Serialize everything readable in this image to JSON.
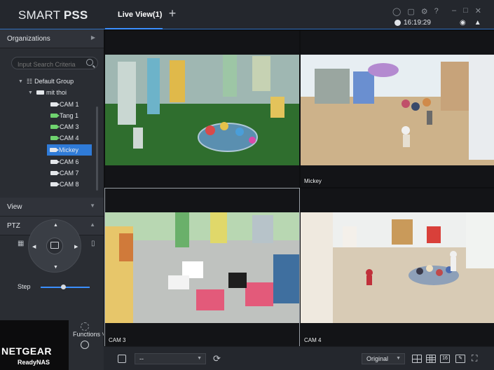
{
  "app": {
    "brand_light": "SMART ",
    "brand_bold": "PSS",
    "tab_label": "Live View(1)",
    "add_tab_symbol": "+",
    "clock": "16:19:29"
  },
  "sidebar": {
    "organizations_label": "Organizations",
    "search_placeholder": "Input Search Criteria",
    "tree": {
      "root": "Default Group",
      "device": "mit thoi",
      "cameras": [
        "CAM 1",
        "Tang 1",
        "CAM 3",
        "CAM 4",
        "Mickey",
        "CAM 6",
        "CAM 7",
        "CAM 8"
      ],
      "selected_camera": "Mickey"
    },
    "view_label": "View",
    "ptz_label": "PTZ",
    "step_label": "Step",
    "step_value": 0.45,
    "functions_label": "Functions"
  },
  "overlay": {
    "netgear": "NETGEAR",
    "readynas": "ReadyNAS"
  },
  "grid": {
    "cells": [
      {
        "label": "",
        "timestamp": ""
      },
      {
        "label": "Mickey",
        "timestamp": ""
      },
      {
        "label": "CAM 3",
        "timestamp": ""
      },
      {
        "label": "CAM 4",
        "timestamp": ""
      }
    ]
  },
  "toolbar": {
    "stream_select": "--",
    "ratio_select": "Original",
    "layout_16": "16"
  },
  "colors": {
    "accent": "#3b8fff",
    "selected_row": "#2f7bd8",
    "online_camera": "#6fd36f"
  }
}
